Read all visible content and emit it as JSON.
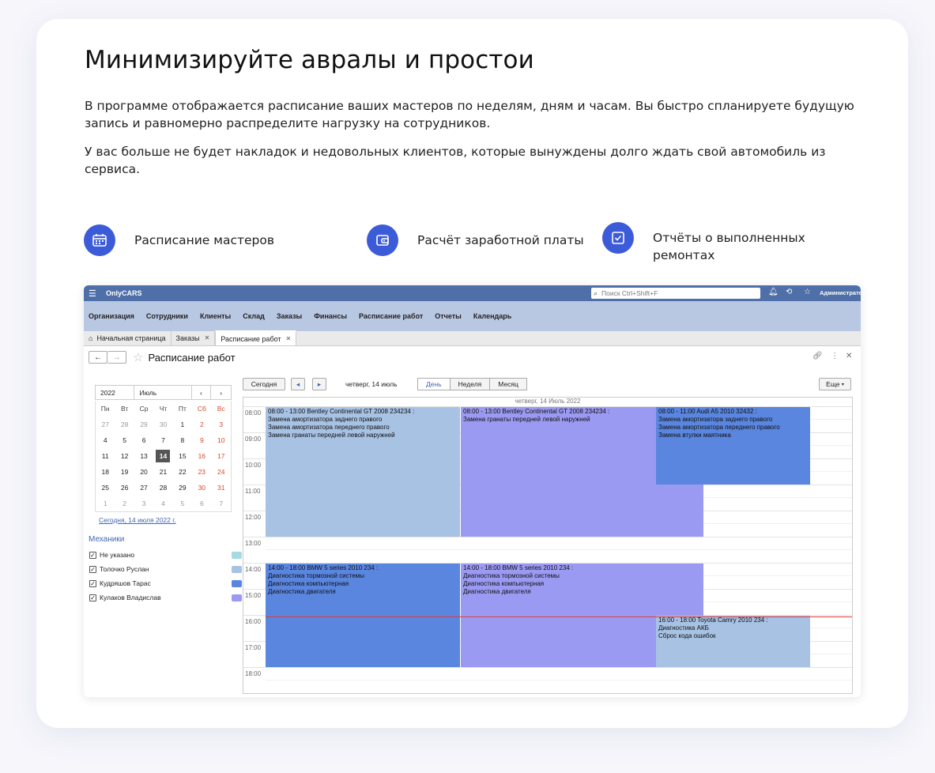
{
  "heading": "Минимизируйте авралы и простои",
  "paragraph1": "В программе отображается расписание ваших мастеров по неделям, дням и часам. Вы быстро спланируете будущую запись и равномерно распределите нагрузку на сотрудников.",
  "paragraph2": "У вас больше не будет накладок и недовольных клиентов, которые вынуждены долго ждать свой автомобиль из сервиса.",
  "features": [
    {
      "label": "Расписание мастеров",
      "icon": "calendar-icon"
    },
    {
      "label": "Расчёт заработной платы",
      "icon": "wallet-icon"
    },
    {
      "label": "Отчёты о выполненных ремонтах",
      "icon": "checklist-icon"
    }
  ],
  "colors": {
    "accent": "#3c5bd8",
    "topbar": "#4e6fa8",
    "menubar": "#b9c8e2"
  },
  "app": {
    "name": "OnlyCARS",
    "search_placeholder": "Поиск Ctrl+Shift+F",
    "user": "Администратор",
    "menu": [
      "Организация",
      "Сотрудники",
      "Клиенты",
      "Склад",
      "Заказы",
      "Финансы",
      "Расписание работ",
      "Отчеты",
      "Календарь"
    ],
    "tabs": [
      "Начальная страница",
      "Заказы",
      "Расписание работ"
    ],
    "page_title": "Расписание работ",
    "calendar": {
      "year": "2022",
      "month": "Июль",
      "prev": "‹",
      "next": "›",
      "weekdays": [
        "Пн",
        "Вт",
        "Ср",
        "Чт",
        "Пт",
        "Сб",
        "Вс"
      ],
      "weeks": [
        [
          "27",
          "28",
          "29",
          "30",
          "1",
          "2",
          "3"
        ],
        [
          "4",
          "5",
          "6",
          "7",
          "8",
          "9",
          "10"
        ],
        [
          "11",
          "12",
          "13",
          "14",
          "15",
          "16",
          "17"
        ],
        [
          "18",
          "19",
          "20",
          "21",
          "22",
          "23",
          "24"
        ],
        [
          "25",
          "26",
          "27",
          "28",
          "29",
          "30",
          "31"
        ],
        [
          "1",
          "2",
          "3",
          "4",
          "5",
          "6",
          "7"
        ]
      ],
      "today_link": "Сегодня, 14 июля 2022 г."
    },
    "mechanics_title": "Механики",
    "mechanics": [
      {
        "name": "Не указано",
        "color": "#a6dbe3"
      },
      {
        "name": "Толочко Руслан",
        "color": "#a8c2e4"
      },
      {
        "name": "Кудряшов Тарас",
        "color": "#5a86df"
      },
      {
        "name": "Кулаков Владислав",
        "color": "#9b9af2"
      }
    ],
    "toolbar": {
      "today": "Сегодня",
      "prev": "◂",
      "next": "▸",
      "date": "четверг, 14 июль",
      "views": [
        "День",
        "Неделя",
        "Месяц"
      ],
      "more": "Еще"
    },
    "grid_day_label": "четверг, 14 Июль 2022",
    "hours": [
      "08:00",
      "09:00",
      "10:00",
      "11:00",
      "12:00",
      "13:00",
      "14:00",
      "15:00",
      "16:00",
      "17:00",
      "18:00"
    ],
    "events": [
      {
        "title": "08:00 - 13:00 Bentley Continental GT 2008 234234 :",
        "lines": [
          "Замена амортизатора заднего правого",
          "Замена амортизатора переднего правого",
          "Замена гранаты передней левой наружней"
        ],
        "color": "#a8c2e4"
      },
      {
        "title": "08:00 - 13:00 Bentley Continental GT 2008 234234 :",
        "lines": [
          "Замена гранаты передней левой наружней"
        ],
        "color": "#9b9af2"
      },
      {
        "title": "08:00 - 11:00 Audi A5 2010 32432 :",
        "lines": [
          "Замена амортизатора заднего правого",
          "Замена амортизатора переднего правого",
          "Замена втулки маятника"
        ],
        "color": "#5a86df"
      },
      {
        "title": "14:00 - 18:00 BMW 5 series 2010 234 :",
        "lines": [
          "Диагностика тормозной системы",
          "Диагностика компьютерная",
          "Диагностика двигателя"
        ],
        "color": "#5a86df"
      },
      {
        "title": "14:00 - 18:00 BMW 5 series 2010 234 :",
        "lines": [
          "Диагностика тормозной системы",
          "Диагностика компьютерная",
          "Диагностика двигателя"
        ],
        "color": "#9b9af2"
      },
      {
        "title": "16:00 - 18:00 Toyota Camry 2010 234 :",
        "lines": [
          "Диагностика АКБ",
          "Сброс кода ошибок"
        ],
        "color": "#a8c2e4"
      }
    ]
  }
}
